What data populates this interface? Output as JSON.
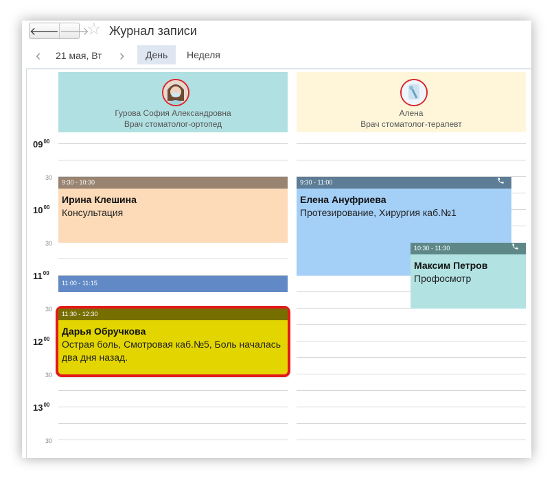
{
  "window": {
    "title": "Журнал записи",
    "nav": {
      "back": "🡐",
      "forward": "🡒"
    }
  },
  "date_nav": {
    "prev": "‹",
    "date": "21 мая, Вт",
    "next": "›"
  },
  "views": [
    {
      "label": "День",
      "active": true
    },
    {
      "label": "Неделя",
      "active": false
    }
  ],
  "doctors": [
    {
      "name": "Гурова София Александровна",
      "role": "Врач стоматолог-ортопед",
      "color": "#b1e0e2"
    },
    {
      "name": "Алена",
      "role": "Врач стоматолог-терапевт",
      "color": "#fff6da"
    }
  ],
  "time_labels": {
    "h09": "09",
    "h10": "10",
    "h11": "11",
    "h12": "12",
    "h13": "13",
    "minutes_00": "00",
    "minutes_30": "30"
  },
  "appointments": [
    {
      "time": "9:30 - 10:30",
      "patient": "Ирина Клешина",
      "description": "Консультация",
      "header_color": "#998371",
      "body_color": "#fddab8"
    },
    {
      "time": "11:00 - 11:15",
      "patient": "",
      "description": "",
      "header_color": "#6189c5",
      "body_color": "#6189c5"
    },
    {
      "time": "11:30 - 12:30",
      "patient": "Дарья Обручкова",
      "description": "Острая боль, Смотровая каб.№5, Боль началась два дня назад.",
      "header_color": "#776e00",
      "body_color": "#e3d600",
      "highlight": "#e31a1a"
    },
    {
      "time": "9:30 - 11:00",
      "patient": "Елена Ануфриева",
      "description": "Протезирование, Хирургия каб.№1",
      "header_color": "#5d7d97",
      "body_color": "#a4cff7",
      "phone_icon": "phone-icon"
    },
    {
      "time": "10:30 - 11:30",
      "patient": "Максим Петров",
      "description": "Профосмотр",
      "header_color": "#5e8888",
      "body_color": "#b2e2e2",
      "phone_icon": "phone-icon"
    }
  ]
}
